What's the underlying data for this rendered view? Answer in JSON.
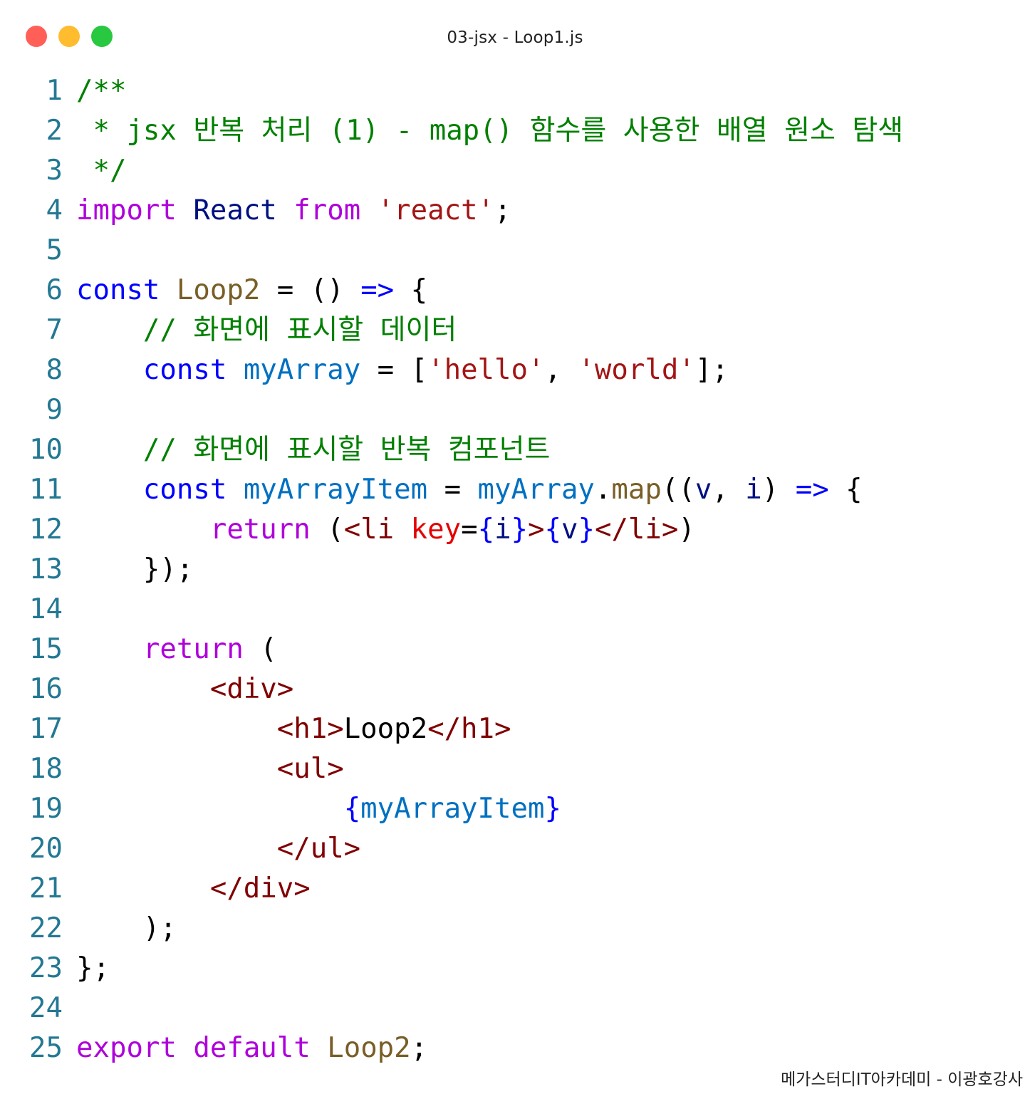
{
  "window": {
    "title": "03-jsx - Loop1.js",
    "controls": [
      "close",
      "minimize",
      "maximize"
    ],
    "colors": {
      "close": "#ff5f57",
      "minimize": "#febc2e",
      "maximize": "#28c840"
    }
  },
  "code": {
    "colors": {
      "comment": "#008000",
      "keyword": "#af00db",
      "declaration": "#0000ff",
      "function": "#795e26",
      "variable": "#0070c1",
      "string": "#a31515",
      "tag": "#800000",
      "attribute": "#e50000",
      "line_number": "#237893"
    },
    "lines": [
      {
        "n": "1",
        "tokens": [
          {
            "t": "/**",
            "c": "com"
          }
        ]
      },
      {
        "n": "2",
        "tokens": [
          {
            "t": " * jsx 반복 처리 (1) - map() 함수를 사용한 배열 원소 탐색",
            "c": "com"
          }
        ]
      },
      {
        "n": "3",
        "tokens": [
          {
            "t": " */",
            "c": "com"
          }
        ]
      },
      {
        "n": "4",
        "tokens": [
          {
            "t": "import",
            "c": "kw"
          },
          {
            "t": " ",
            "c": "txt"
          },
          {
            "t": "React",
            "c": "type"
          },
          {
            "t": " ",
            "c": "txt"
          },
          {
            "t": "from",
            "c": "kw"
          },
          {
            "t": " ",
            "c": "txt"
          },
          {
            "t": "'react'",
            "c": "str"
          },
          {
            "t": ";",
            "c": "txt"
          }
        ]
      },
      {
        "n": "5",
        "tokens": []
      },
      {
        "n": "6",
        "tokens": [
          {
            "t": "const",
            "c": "decl"
          },
          {
            "t": " ",
            "c": "txt"
          },
          {
            "t": "Loop2",
            "c": "fn"
          },
          {
            "t": " = () ",
            "c": "txt"
          },
          {
            "t": "=>",
            "c": "decl"
          },
          {
            "t": " {",
            "c": "txt"
          }
        ]
      },
      {
        "n": "7",
        "tokens": [
          {
            "t": "    ",
            "c": "txt"
          },
          {
            "t": "// 화면에 표시할 데이터",
            "c": "com"
          }
        ]
      },
      {
        "n": "8",
        "tokens": [
          {
            "t": "    ",
            "c": "txt"
          },
          {
            "t": "const",
            "c": "decl"
          },
          {
            "t": " ",
            "c": "txt"
          },
          {
            "t": "myArray",
            "c": "var"
          },
          {
            "t": " = [",
            "c": "txt"
          },
          {
            "t": "'hello'",
            "c": "str"
          },
          {
            "t": ", ",
            "c": "txt"
          },
          {
            "t": "'world'",
            "c": "str"
          },
          {
            "t": "];",
            "c": "txt"
          }
        ]
      },
      {
        "n": "9",
        "tokens": []
      },
      {
        "n": "10",
        "tokens": [
          {
            "t": "    ",
            "c": "txt"
          },
          {
            "t": "// 화면에 표시할 반복 컴포넌트",
            "c": "com"
          }
        ]
      },
      {
        "n": "11",
        "tokens": [
          {
            "t": "    ",
            "c": "txt"
          },
          {
            "t": "const",
            "c": "decl"
          },
          {
            "t": " ",
            "c": "txt"
          },
          {
            "t": "myArrayItem",
            "c": "var"
          },
          {
            "t": " = ",
            "c": "txt"
          },
          {
            "t": "myArray",
            "c": "var"
          },
          {
            "t": ".",
            "c": "txt"
          },
          {
            "t": "map",
            "c": "fn"
          },
          {
            "t": "((",
            "c": "txt"
          },
          {
            "t": "v",
            "c": "type"
          },
          {
            "t": ", ",
            "c": "txt"
          },
          {
            "t": "i",
            "c": "type"
          },
          {
            "t": ") ",
            "c": "txt"
          },
          {
            "t": "=>",
            "c": "decl"
          },
          {
            "t": " {",
            "c": "txt"
          }
        ]
      },
      {
        "n": "12",
        "tokens": [
          {
            "t": "        ",
            "c": "txt"
          },
          {
            "t": "return",
            "c": "kw"
          },
          {
            "t": " (",
            "c": "txt"
          },
          {
            "t": "<li",
            "c": "tag"
          },
          {
            "t": " ",
            "c": "txt"
          },
          {
            "t": "key",
            "c": "attr"
          },
          {
            "t": "=",
            "c": "txt"
          },
          {
            "t": "{",
            "c": "decl"
          },
          {
            "t": "i",
            "c": "type"
          },
          {
            "t": "}",
            "c": "decl"
          },
          {
            "t": ">",
            "c": "tag"
          },
          {
            "t": "{",
            "c": "decl"
          },
          {
            "t": "v",
            "c": "type"
          },
          {
            "t": "}",
            "c": "decl"
          },
          {
            "t": "</li>",
            "c": "tag"
          },
          {
            "t": ")",
            "c": "txt"
          }
        ]
      },
      {
        "n": "13",
        "tokens": [
          {
            "t": "    });",
            "c": "txt"
          }
        ]
      },
      {
        "n": "14",
        "tokens": []
      },
      {
        "n": "15",
        "tokens": [
          {
            "t": "    ",
            "c": "txt"
          },
          {
            "t": "return",
            "c": "kw"
          },
          {
            "t": " (",
            "c": "txt"
          }
        ]
      },
      {
        "n": "16",
        "tokens": [
          {
            "t": "        ",
            "c": "txt"
          },
          {
            "t": "<div>",
            "c": "tag"
          }
        ]
      },
      {
        "n": "17",
        "tokens": [
          {
            "t": "            ",
            "c": "txt"
          },
          {
            "t": "<h1>",
            "c": "tag"
          },
          {
            "t": "Loop2",
            "c": "txt"
          },
          {
            "t": "</h1>",
            "c": "tag"
          }
        ]
      },
      {
        "n": "18",
        "tokens": [
          {
            "t": "            ",
            "c": "txt"
          },
          {
            "t": "<ul>",
            "c": "tag"
          }
        ]
      },
      {
        "n": "19",
        "tokens": [
          {
            "t": "                ",
            "c": "txt"
          },
          {
            "t": "{",
            "c": "decl"
          },
          {
            "t": "myArrayItem",
            "c": "var"
          },
          {
            "t": "}",
            "c": "decl"
          }
        ]
      },
      {
        "n": "20",
        "tokens": [
          {
            "t": "            ",
            "c": "txt"
          },
          {
            "t": "</ul>",
            "c": "tag"
          }
        ]
      },
      {
        "n": "21",
        "tokens": [
          {
            "t": "        ",
            "c": "txt"
          },
          {
            "t": "</div>",
            "c": "tag"
          }
        ]
      },
      {
        "n": "22",
        "tokens": [
          {
            "t": "    );",
            "c": "txt"
          }
        ]
      },
      {
        "n": "23",
        "tokens": [
          {
            "t": "};",
            "c": "txt"
          }
        ]
      },
      {
        "n": "24",
        "tokens": []
      },
      {
        "n": "25",
        "tokens": [
          {
            "t": "export",
            "c": "kw"
          },
          {
            "t": " ",
            "c": "txt"
          },
          {
            "t": "default",
            "c": "kw"
          },
          {
            "t": " ",
            "c": "txt"
          },
          {
            "t": "Loop2",
            "c": "fn"
          },
          {
            "t": ";",
            "c": "txt"
          }
        ]
      }
    ]
  },
  "footer": {
    "credit": "메가스터디IT아카데미 - 이광호강사"
  }
}
